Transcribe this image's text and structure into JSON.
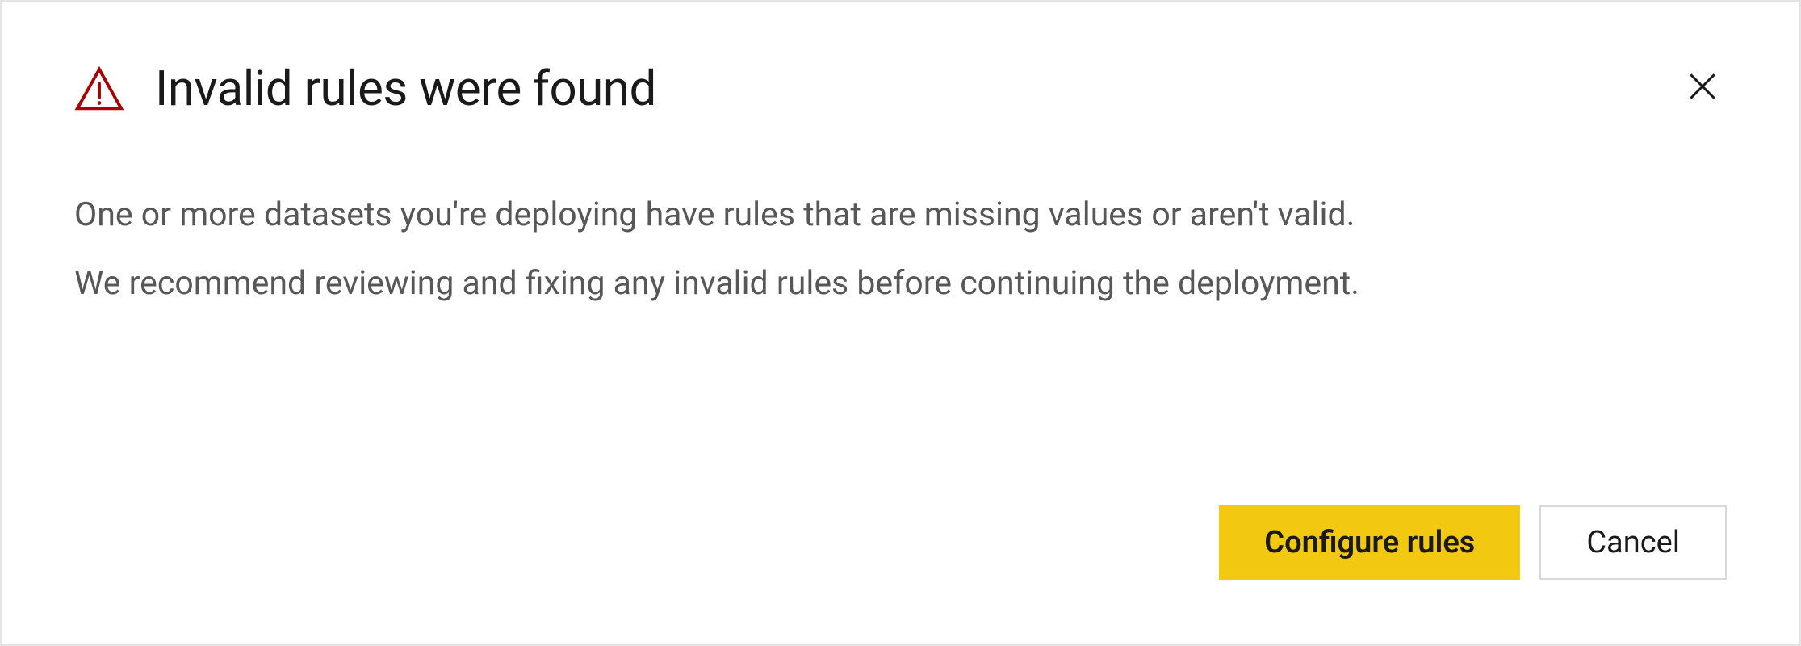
{
  "dialog": {
    "title": "Invalid rules were found",
    "message_line_1": "One or more datasets you're deploying have rules that are missing values or aren't valid.",
    "message_line_2": "We recommend reviewing and fixing any invalid rules before continuing the deployment.",
    "primary_button_label": "Configure rules",
    "secondary_button_label": "Cancel",
    "icons": {
      "warning": "warning-triangle",
      "close": "close-x"
    },
    "colors": {
      "accent": "#f2c811",
      "warning": "#a80000",
      "text_primary": "#1a1a1a",
      "text_secondary": "#575757"
    }
  }
}
